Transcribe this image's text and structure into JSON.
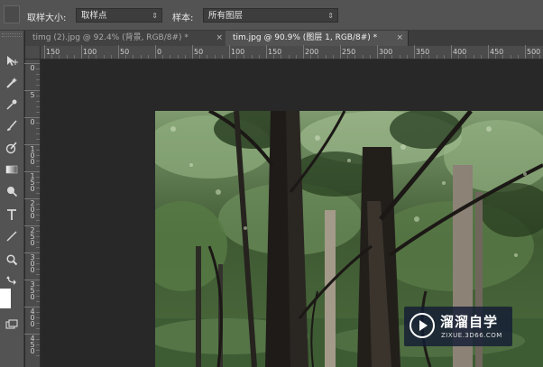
{
  "options_bar": {
    "sample_size_label": "取样大小:",
    "sample_size_value": "取样点",
    "sample_label": "样本:",
    "sample_value": "所有图层"
  },
  "tabs": [
    {
      "label": "timg (2).jpg @ 92.4% (背景, RGB/8#) *",
      "close": "×",
      "active": false
    },
    {
      "label": "tim.jpg @ 90.9% (图层 1, RGB/8#) *",
      "close": "×",
      "active": true
    }
  ],
  "ruler_h": {
    "ticks": [
      "150",
      "100",
      "50",
      "0",
      "50",
      "100",
      "150",
      "200",
      "250",
      "300",
      "350",
      "400",
      "450",
      "500"
    ]
  },
  "ruler_v": {
    "ticks": [
      "0",
      "5",
      "0",
      "1\n0\n0",
      "1\n5\n0",
      "2\n0\n0",
      "2\n5\n0",
      "3\n0\n0",
      "3\n5\n0",
      "4\n0\n0",
      "4\n5\n0"
    ]
  },
  "tools": [
    {
      "name": "move-tool-icon"
    },
    {
      "name": "magic-wand-tool-icon"
    },
    {
      "name": "eyedropper-tool-icon"
    },
    {
      "name": "brush-tool-icon"
    },
    {
      "name": "history-brush-tool-icon"
    },
    {
      "name": "gradient-tool-icon"
    },
    {
      "name": "dodge-tool-icon"
    },
    {
      "name": "type-tool-icon"
    },
    {
      "name": "line-tool-icon"
    },
    {
      "name": "zoom-tool-icon"
    },
    {
      "name": "swap-colors-icon"
    }
  ],
  "watermark": {
    "brand": "溜溜自学",
    "url": "ZIXUE.3D66.COM"
  },
  "colors": {
    "panel": "#535353",
    "workspace": "#282828",
    "watermark_bg": "#141c34"
  }
}
